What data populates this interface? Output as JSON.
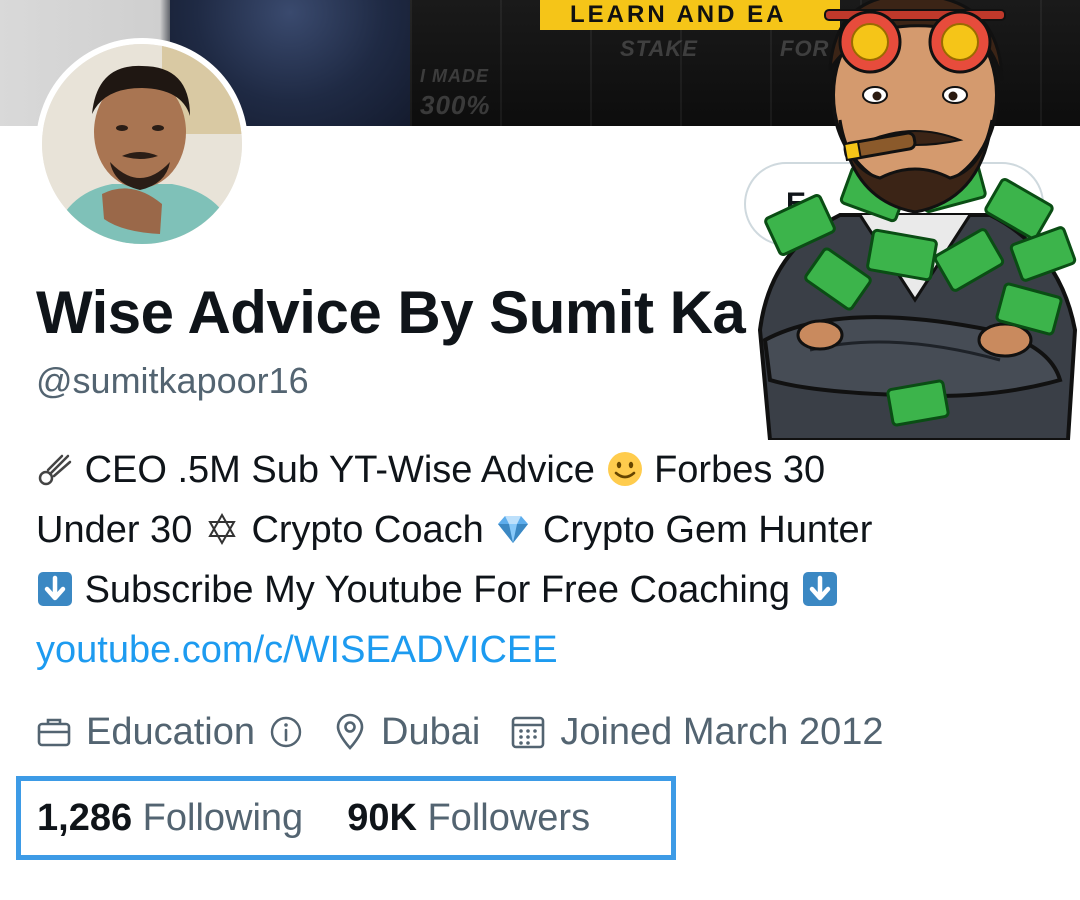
{
  "banner": {
    "strip_text": "LEARN AND EA",
    "faded_texts": [
      "STAKE",
      "FOR",
      "I MADE",
      "300%"
    ]
  },
  "profile": {
    "edit_button_label": "E",
    "display_name": "Wise Advice By Sumit Ka",
    "handle": "@sumitkapoor16"
  },
  "bio": {
    "line1_prefix": "CEO .5M Sub YT-Wise Advice",
    "line1_suffix": "Forbes 30",
    "line2_prefix": "Under 30",
    "line2_mid": "Crypto Coach",
    "line2_suffix": "Crypto Gem Hunter",
    "line3_text": "Subscribe My Youtube For Free Coaching",
    "link": "youtube.com/c/WISEADVICEE"
  },
  "meta": {
    "category": "Education",
    "location": "Dubai",
    "joined": "Joined March 2012"
  },
  "stats": {
    "following_count": "1,286",
    "following_label": "Following",
    "followers_count": "90K",
    "followers_label": "Followers"
  },
  "colors": {
    "link": "#1d9bf0",
    "secondary_text": "#536471",
    "highlight_box": "#3d9be6",
    "banner_strip": "#f5c518"
  },
  "icons": [
    "comet-icon",
    "smiley-emoji-icon",
    "star-of-david-icon",
    "gem-icon",
    "down-arrow-emoji-icon",
    "briefcase-icon",
    "info-icon",
    "location-pin-icon",
    "calendar-icon"
  ]
}
